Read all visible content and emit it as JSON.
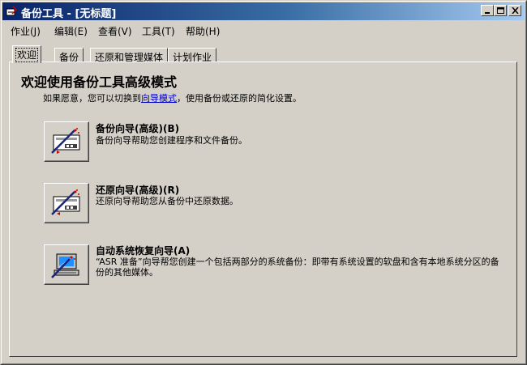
{
  "window": {
    "title": "备份工具 - [无标题]",
    "controls": {
      "minimize": "minimize",
      "maximize": "maximize",
      "close": "close"
    }
  },
  "menu": {
    "items": [
      {
        "label": "作业(J)"
      },
      {
        "label": "编辑(E)"
      },
      {
        "label": "查看(V)"
      },
      {
        "label": "工具(T)"
      },
      {
        "label": "帮助(H)"
      }
    ]
  },
  "tabs": [
    {
      "label": "欢迎",
      "active": true
    },
    {
      "label": "备份"
    },
    {
      "label": "还原和管理媒体"
    },
    {
      "label": "计划作业"
    }
  ],
  "welcome": {
    "heading": "欢迎使用备份工具高级模式",
    "intro_before": "如果愿意，您可以切换到",
    "intro_link": "向导模式",
    "intro_after": "，使用备份或还原的简化设置。"
  },
  "options": [
    {
      "title": "备份向导(高级)(B)",
      "description": "备份向导帮助您创建程序和文件备份。",
      "icon": "backup-wizard-icon"
    },
    {
      "title": "还原向导(高级)(R)",
      "description": "还原向导帮助您从备份中还原数据。",
      "icon": "restore-wizard-icon"
    },
    {
      "title": "自动系统恢复向导(A)",
      "description": "“ASR 准备”向导帮您创建一个包括两部分的系统备份：即带有系统设置的软盘和含有本地系统分区的备份的其他媒体。",
      "icon": "asr-wizard-icon"
    }
  ]
}
